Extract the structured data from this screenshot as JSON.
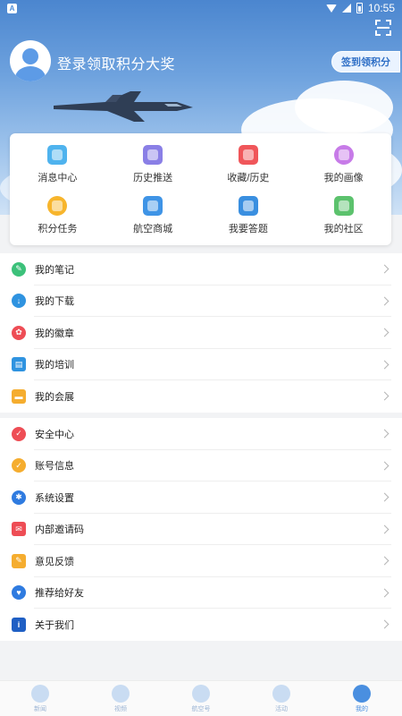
{
  "status_bar": {
    "time": "10:55",
    "app_badge": "A"
  },
  "header": {
    "login_text": "登录领取积分大奖",
    "checkin_button": "签到领积分"
  },
  "quick_grid": [
    {
      "label": "消息中心",
      "icon": "message-icon",
      "color": "#4fb3ee"
    },
    {
      "label": "历史推送",
      "icon": "calendar-icon",
      "color": "#8a7fe6"
    },
    {
      "label": "收藏/历史",
      "icon": "folder-icon",
      "color": "#f0565a"
    },
    {
      "label": "我的画像",
      "icon": "heart-icon",
      "color": "#c77be8"
    },
    {
      "label": "积分任务",
      "icon": "coin-icon",
      "color": "#f7b52c"
    },
    {
      "label": "航空商城",
      "icon": "store-icon",
      "color": "#3f94e6"
    },
    {
      "label": "我要答题",
      "icon": "book-icon",
      "color": "#3a8fe0"
    },
    {
      "label": "我的社区",
      "icon": "community-icon",
      "color": "#5cc26d"
    }
  ],
  "menu_group_1": [
    {
      "label": "我的笔记",
      "icon": "leaf-icon",
      "color": "#3cc17a"
    },
    {
      "label": "我的下载",
      "icon": "download-icon",
      "color": "#2f93e0"
    },
    {
      "label": "我的徽章",
      "icon": "badge-icon",
      "color": "#ee4d55"
    },
    {
      "label": "我的培训",
      "icon": "training-icon",
      "color": "#2f93e0"
    },
    {
      "label": "我的会展",
      "icon": "exhibition-icon",
      "color": "#f5ad2f"
    }
  ],
  "menu_group_2": [
    {
      "label": "安全中心",
      "icon": "shield-icon",
      "color": "#ee4d55"
    },
    {
      "label": "账号信息",
      "icon": "account-icon",
      "color": "#f5ad2f"
    },
    {
      "label": "系统设置",
      "icon": "gear-icon",
      "color": "#2f7be0"
    },
    {
      "label": "内部邀请码",
      "icon": "mail-icon",
      "color": "#ee4d55"
    },
    {
      "label": "意见反馈",
      "icon": "feedback-icon",
      "color": "#f5ad2f"
    },
    {
      "label": "推荐给好友",
      "icon": "thumbs-up-icon",
      "color": "#2f7be0"
    },
    {
      "label": "关于我们",
      "icon": "info-icon",
      "color": "#1f5fc4"
    }
  ],
  "bottom_nav": [
    {
      "label": "新闻",
      "active": false
    },
    {
      "label": "视频",
      "active": false
    },
    {
      "label": "航空号",
      "active": false
    },
    {
      "label": "活动",
      "active": false
    },
    {
      "label": "我的",
      "active": true
    }
  ]
}
